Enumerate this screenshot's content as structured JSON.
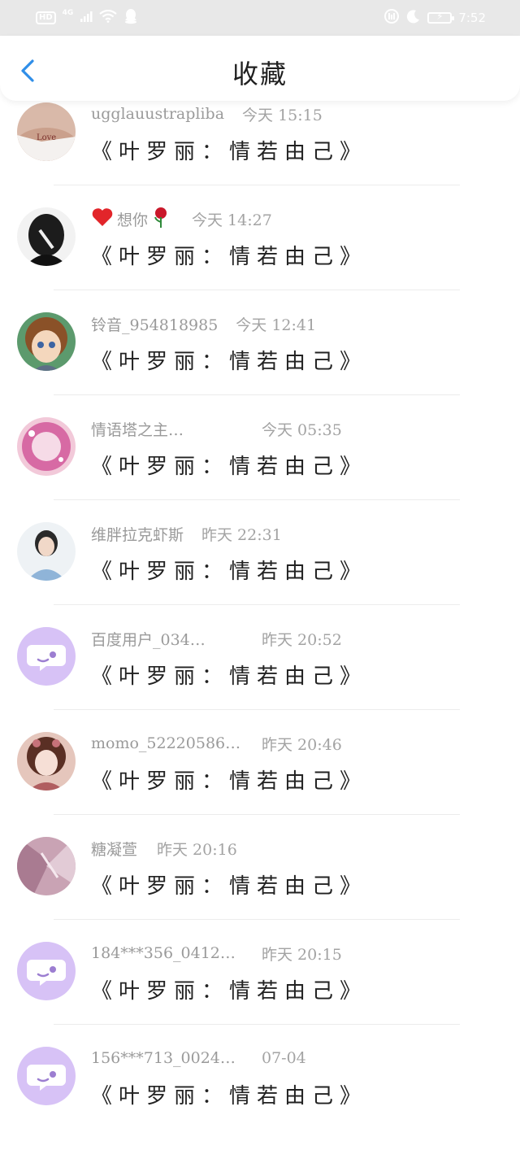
{
  "status_bar": {
    "hd_badge": "HD",
    "network": "4G",
    "time": "7:52"
  },
  "header": {
    "title": "收藏",
    "back_icon": "chevron-left-icon"
  },
  "colors": {
    "accent": "#2f8ee8",
    "placeholder_avatar": "#d7c2f6"
  },
  "items": [
    {
      "name": "ugglauustrapliba",
      "time": "今天 15:15",
      "title": "《叶罗丽：情若由己》",
      "avatar": "photo"
    },
    {
      "name": "想你",
      "time": "今天 14:27",
      "title": "《叶罗丽：情若由己》",
      "avatar": "photo"
    },
    {
      "name": "铃音_954818985",
      "time": "今天 12:41",
      "title": "《叶罗丽：情若由己》",
      "avatar": "photo"
    },
    {
      "name": "情语塔之主…",
      "time": "今天 05:35",
      "title": "《叶罗丽：情若由己》",
      "avatar": "photo"
    },
    {
      "name": "维胖拉克虾斯",
      "time": "昨天 22:31",
      "title": "《叶罗丽：情若由己》",
      "avatar": "photo"
    },
    {
      "name": "百度用户_034…",
      "time": "昨天 20:52",
      "title": "《叶罗丽：情若由己》",
      "avatar": "default"
    },
    {
      "name": "momo_52220586…",
      "time": "昨天 20:46",
      "title": "《叶罗丽：情若由己》",
      "avatar": "photo"
    },
    {
      "name": "糖凝萱",
      "time": "昨天 20:16",
      "title": "《叶罗丽：情若由己》",
      "avatar": "photo"
    },
    {
      "name": "184***356_0412…",
      "time": "昨天 20:15",
      "title": "《叶罗丽：情若由己》",
      "avatar": "default"
    },
    {
      "name": "156***713_0024…",
      "time": "07-04",
      "title": "《叶罗丽：情若由己》",
      "avatar": "default"
    }
  ]
}
